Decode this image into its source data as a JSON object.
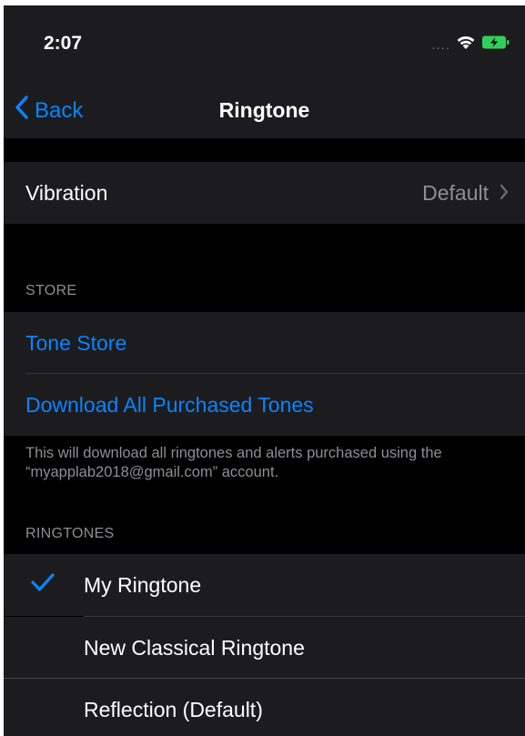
{
  "status_bar": {
    "time": "2:07",
    "signal_text": "....",
    "icons": [
      "wifi-icon",
      "battery-charging-icon"
    ]
  },
  "nav": {
    "back_label": "Back",
    "title": "Ringtone"
  },
  "vibration": {
    "label": "Vibration",
    "value": "Default"
  },
  "store": {
    "header": "STORE",
    "items": [
      {
        "label": "Tone Store"
      },
      {
        "label": "Download All Purchased Tones"
      }
    ],
    "footer": "This will download all ringtones and alerts purchased using the “myapplab2018@gmail.com” account."
  },
  "ringtones": {
    "header": "RINGTONES",
    "items": [
      {
        "label": "My Ringtone",
        "selected": true
      },
      {
        "label": "New Classical Ringtone",
        "selected": false
      },
      {
        "label": "Reflection (Default)",
        "selected": false
      }
    ]
  },
  "colors": {
    "accent": "#0a84ff",
    "background": "#000000",
    "cell": "#1c1c1e",
    "secondary_text": "#8e8e93",
    "battery": "#30d158"
  }
}
